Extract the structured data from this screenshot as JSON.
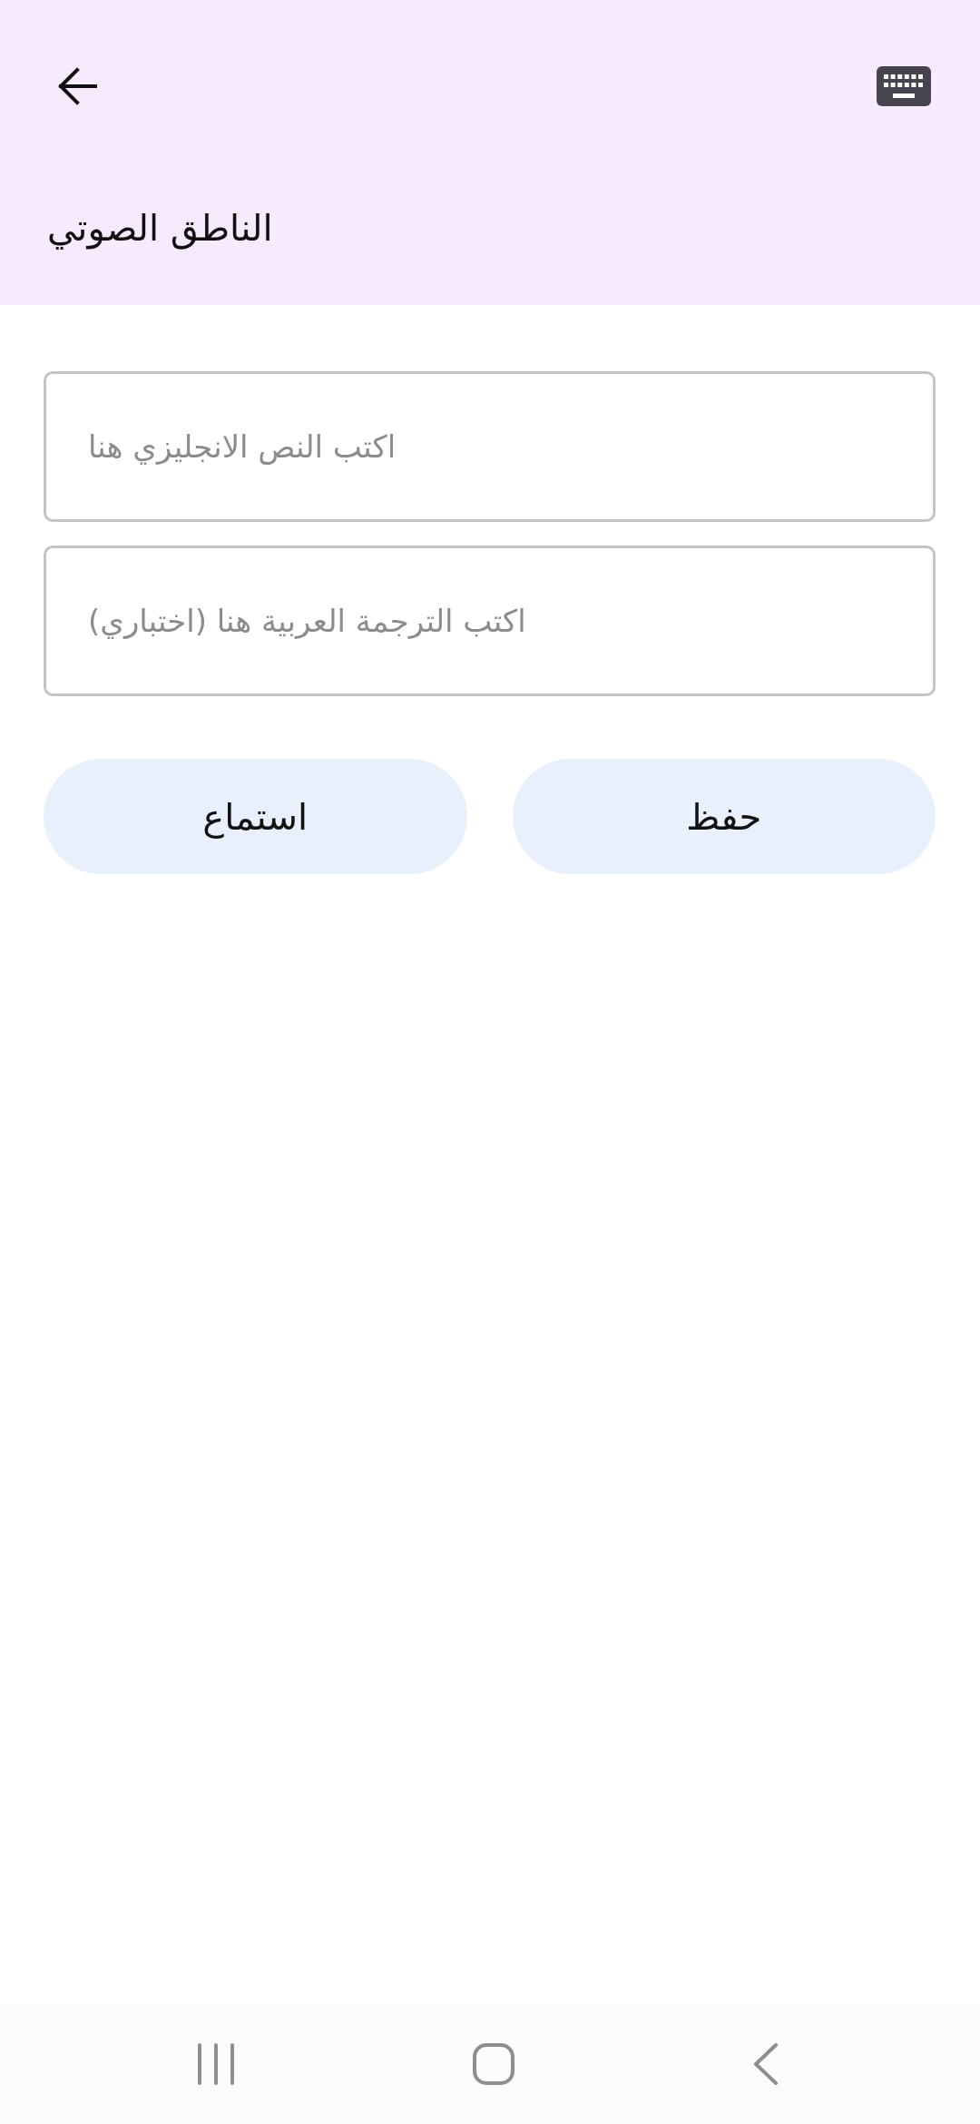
{
  "app_bar": {
    "title": "الناطق الصوتي"
  },
  "fields": [
    {
      "placeholder": "اكتب النص الانجليزي هنا"
    },
    {
      "placeholder": "اكتب الترجمة العربية هنا (اختباري)"
    }
  ],
  "buttons": [
    "حفظ",
    "استماع"
  ]
}
